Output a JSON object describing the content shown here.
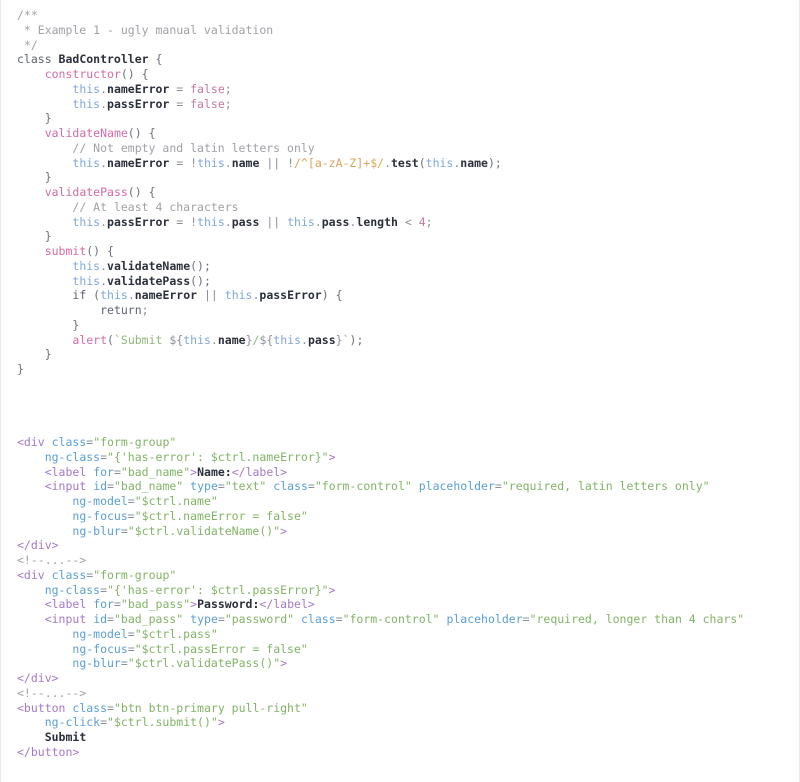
{
  "document": {
    "type": "code-listing",
    "title": "Example 1 - ugly manual validation",
    "background_color": "#ffffff",
    "font": "monospace",
    "colors": {
      "comment": "#a0a1a7",
      "keyword": "#5c6370",
      "function": "#d36ba6",
      "this": "#7fa8d6",
      "property": "#2b303b",
      "literal": "#c678a0",
      "regex": "#d8a657",
      "string": "#8cb87a",
      "tag": "#a579c9",
      "attribute": "#5a9fd4",
      "attribute_value": "#82b366",
      "text": "#2b303b",
      "border": "#e8e8e8"
    }
  },
  "js_block": {
    "language": "javascript",
    "lines": [
      [
        {
          "t": "/**",
          "c": "c"
        }
      ],
      [
        {
          "t": " * Example 1 - ugly manual validation",
          "c": "c"
        }
      ],
      [
        {
          "t": " */",
          "c": "c"
        }
      ],
      [
        {
          "t": "class ",
          "c": "kw"
        },
        {
          "t": "BadController",
          "c": "cls"
        },
        {
          "t": " {",
          "c": "pun"
        }
      ],
      [
        {
          "t": "    ",
          "c": "pun"
        },
        {
          "t": "constructor",
          "c": "fn"
        },
        {
          "t": "() {",
          "c": "pun"
        }
      ],
      [
        {
          "t": "        ",
          "c": "pun"
        },
        {
          "t": "this",
          "c": "th"
        },
        {
          "t": ".",
          "c": "op"
        },
        {
          "t": "nameError",
          "c": "prop"
        },
        {
          "t": " = ",
          "c": "op"
        },
        {
          "t": "false",
          "c": "val"
        },
        {
          "t": ";",
          "c": "op"
        }
      ],
      [
        {
          "t": "        ",
          "c": "pun"
        },
        {
          "t": "this",
          "c": "th"
        },
        {
          "t": ".",
          "c": "op"
        },
        {
          "t": "passError",
          "c": "prop"
        },
        {
          "t": " = ",
          "c": "op"
        },
        {
          "t": "false",
          "c": "val"
        },
        {
          "t": ";",
          "c": "op"
        }
      ],
      [
        {
          "t": "    }",
          "c": "pun"
        }
      ],
      [
        {
          "t": "    ",
          "c": "pun"
        },
        {
          "t": "validateName",
          "c": "fn"
        },
        {
          "t": "() {",
          "c": "pun"
        }
      ],
      [
        {
          "t": "        ",
          "c": "pun"
        },
        {
          "t": "// Not empty and latin letters only",
          "c": "c"
        }
      ],
      [
        {
          "t": "        ",
          "c": "pun"
        },
        {
          "t": "this",
          "c": "th"
        },
        {
          "t": ".",
          "c": "op"
        },
        {
          "t": "nameError",
          "c": "prop"
        },
        {
          "t": " = ",
          "c": "op"
        },
        {
          "t": "!",
          "c": "op"
        },
        {
          "t": "this",
          "c": "th"
        },
        {
          "t": ".",
          "c": "op"
        },
        {
          "t": "name",
          "c": "prop"
        },
        {
          "t": " || ",
          "c": "op"
        },
        {
          "t": "!",
          "c": "op"
        },
        {
          "t": "/^[a-zA-Z]+$/",
          "c": "re"
        },
        {
          "t": ".",
          "c": "op"
        },
        {
          "t": "test",
          "c": "prop"
        },
        {
          "t": "(",
          "c": "pun"
        },
        {
          "t": "this",
          "c": "th"
        },
        {
          "t": ".",
          "c": "op"
        },
        {
          "t": "name",
          "c": "prop"
        },
        {
          "t": ");",
          "c": "pun"
        }
      ],
      [
        {
          "t": "    }",
          "c": "pun"
        }
      ],
      [
        {
          "t": "    ",
          "c": "pun"
        },
        {
          "t": "validatePass",
          "c": "fn"
        },
        {
          "t": "() {",
          "c": "pun"
        }
      ],
      [
        {
          "t": "        ",
          "c": "pun"
        },
        {
          "t": "// At least 4 characters",
          "c": "c"
        }
      ],
      [
        {
          "t": "        ",
          "c": "pun"
        },
        {
          "t": "this",
          "c": "th"
        },
        {
          "t": ".",
          "c": "op"
        },
        {
          "t": "passError",
          "c": "prop"
        },
        {
          "t": " = ",
          "c": "op"
        },
        {
          "t": "!",
          "c": "op"
        },
        {
          "t": "this",
          "c": "th"
        },
        {
          "t": ".",
          "c": "op"
        },
        {
          "t": "pass",
          "c": "prop"
        },
        {
          "t": " || ",
          "c": "op"
        },
        {
          "t": "this",
          "c": "th"
        },
        {
          "t": ".",
          "c": "op"
        },
        {
          "t": "pass",
          "c": "prop"
        },
        {
          "t": ".",
          "c": "op"
        },
        {
          "t": "length",
          "c": "prop"
        },
        {
          "t": " < ",
          "c": "op"
        },
        {
          "t": "4",
          "c": "num"
        },
        {
          "t": ";",
          "c": "op"
        }
      ],
      [
        {
          "t": "    }",
          "c": "pun"
        }
      ],
      [
        {
          "t": "    ",
          "c": "pun"
        },
        {
          "t": "submit",
          "c": "fn"
        },
        {
          "t": "() {",
          "c": "pun"
        }
      ],
      [
        {
          "t": "        ",
          "c": "pun"
        },
        {
          "t": "this",
          "c": "th"
        },
        {
          "t": ".",
          "c": "op"
        },
        {
          "t": "validateName",
          "c": "prop"
        },
        {
          "t": "();",
          "c": "pun"
        }
      ],
      [
        {
          "t": "        ",
          "c": "pun"
        },
        {
          "t": "this",
          "c": "th"
        },
        {
          "t": ".",
          "c": "op"
        },
        {
          "t": "validatePass",
          "c": "prop"
        },
        {
          "t": "();",
          "c": "pun"
        }
      ],
      [
        {
          "t": "        ",
          "c": "pun"
        },
        {
          "t": "if",
          "c": "kw"
        },
        {
          "t": " (",
          "c": "pun"
        },
        {
          "t": "this",
          "c": "th"
        },
        {
          "t": ".",
          "c": "op"
        },
        {
          "t": "nameError",
          "c": "prop"
        },
        {
          "t": " || ",
          "c": "op"
        },
        {
          "t": "this",
          "c": "th"
        },
        {
          "t": ".",
          "c": "op"
        },
        {
          "t": "passError",
          "c": "prop"
        },
        {
          "t": ") {",
          "c": "pun"
        }
      ],
      [
        {
          "t": "            ",
          "c": "pun"
        },
        {
          "t": "return",
          "c": "kw"
        },
        {
          "t": ";",
          "c": "op"
        }
      ],
      [
        {
          "t": "        }",
          "c": "pun"
        }
      ],
      [
        {
          "t": "        ",
          "c": "pun"
        },
        {
          "t": "alert",
          "c": "fn"
        },
        {
          "t": "(",
          "c": "pun"
        },
        {
          "t": "`",
          "c": "str"
        },
        {
          "t": "Submit ",
          "c": "str"
        },
        {
          "t": "${",
          "c": "op"
        },
        {
          "t": "this",
          "c": "th"
        },
        {
          "t": ".",
          "c": "op"
        },
        {
          "t": "name",
          "c": "prop"
        },
        {
          "t": "}",
          "c": "op"
        },
        {
          "t": "/",
          "c": "str"
        },
        {
          "t": "${",
          "c": "op"
        },
        {
          "t": "this",
          "c": "th"
        },
        {
          "t": ".",
          "c": "op"
        },
        {
          "t": "pass",
          "c": "prop"
        },
        {
          "t": "}",
          "c": "op"
        },
        {
          "t": "`",
          "c": "str"
        },
        {
          "t": ");",
          "c": "pun"
        }
      ],
      [
        {
          "t": "    }",
          "c": "pun"
        }
      ],
      [
        {
          "t": "}",
          "c": "pun"
        }
      ]
    ]
  },
  "html_block": {
    "language": "html",
    "lines": [
      [
        {
          "t": "<div",
          "c": "tag"
        },
        {
          "t": " ",
          "c": "pun"
        },
        {
          "t": "class",
          "c": "attr"
        },
        {
          "t": "=",
          "c": "eq"
        },
        {
          "t": "\"form-group\"",
          "c": "aval"
        }
      ],
      [
        {
          "t": "    ",
          "c": "pun"
        },
        {
          "t": "ng-class",
          "c": "attr"
        },
        {
          "t": "=",
          "c": "eq"
        },
        {
          "t": "\"{'has-error': $ctrl.nameError}\"",
          "c": "aval"
        },
        {
          "t": ">",
          "c": "tag"
        }
      ],
      [
        {
          "t": "    ",
          "c": "pun"
        },
        {
          "t": "<label",
          "c": "tag"
        },
        {
          "t": " ",
          "c": "pun"
        },
        {
          "t": "for",
          "c": "attr"
        },
        {
          "t": "=",
          "c": "eq"
        },
        {
          "t": "\"bad_name\"",
          "c": "aval"
        },
        {
          "t": ">",
          "c": "tag"
        },
        {
          "t": "Name:",
          "c": "txt"
        },
        {
          "t": "</label>",
          "c": "tag"
        }
      ],
      [
        {
          "t": "    ",
          "c": "pun"
        },
        {
          "t": "<input",
          "c": "tag"
        },
        {
          "t": " ",
          "c": "pun"
        },
        {
          "t": "id",
          "c": "attr"
        },
        {
          "t": "=",
          "c": "eq"
        },
        {
          "t": "\"bad_name\"",
          "c": "aval"
        },
        {
          "t": " ",
          "c": "pun"
        },
        {
          "t": "type",
          "c": "attr"
        },
        {
          "t": "=",
          "c": "eq"
        },
        {
          "t": "\"text\"",
          "c": "aval"
        },
        {
          "t": " ",
          "c": "pun"
        },
        {
          "t": "class",
          "c": "attr"
        },
        {
          "t": "=",
          "c": "eq"
        },
        {
          "t": "\"form-control\"",
          "c": "aval"
        },
        {
          "t": " ",
          "c": "pun"
        },
        {
          "t": "placeholder",
          "c": "attr"
        },
        {
          "t": "=",
          "c": "eq"
        },
        {
          "t": "\"required, latin letters only\"",
          "c": "aval"
        }
      ],
      [
        {
          "t": "        ",
          "c": "pun"
        },
        {
          "t": "ng-model",
          "c": "attr"
        },
        {
          "t": "=",
          "c": "eq"
        },
        {
          "t": "\"$ctrl.name\"",
          "c": "aval"
        }
      ],
      [
        {
          "t": "        ",
          "c": "pun"
        },
        {
          "t": "ng-focus",
          "c": "attr"
        },
        {
          "t": "=",
          "c": "eq"
        },
        {
          "t": "\"$ctrl.nameError = false\"",
          "c": "aval"
        }
      ],
      [
        {
          "t": "        ",
          "c": "pun"
        },
        {
          "t": "ng-blur",
          "c": "attr"
        },
        {
          "t": "=",
          "c": "eq"
        },
        {
          "t": "\"$ctrl.validateName()\"",
          "c": "aval"
        },
        {
          "t": ">",
          "c": "tag"
        }
      ],
      [
        {
          "t": "</div>",
          "c": "tag"
        }
      ],
      [
        {
          "t": "<!--...-->",
          "c": "hcom"
        }
      ],
      [
        {
          "t": "<div",
          "c": "tag"
        },
        {
          "t": " ",
          "c": "pun"
        },
        {
          "t": "class",
          "c": "attr"
        },
        {
          "t": "=",
          "c": "eq"
        },
        {
          "t": "\"form-group\"",
          "c": "aval"
        }
      ],
      [
        {
          "t": "    ",
          "c": "pun"
        },
        {
          "t": "ng-class",
          "c": "attr"
        },
        {
          "t": "=",
          "c": "eq"
        },
        {
          "t": "\"{'has-error': $ctrl.passError}\"",
          "c": "aval"
        },
        {
          "t": ">",
          "c": "tag"
        }
      ],
      [
        {
          "t": "    ",
          "c": "pun"
        },
        {
          "t": "<label",
          "c": "tag"
        },
        {
          "t": " ",
          "c": "pun"
        },
        {
          "t": "for",
          "c": "attr"
        },
        {
          "t": "=",
          "c": "eq"
        },
        {
          "t": "\"bad_pass\"",
          "c": "aval"
        },
        {
          "t": ">",
          "c": "tag"
        },
        {
          "t": "Password:",
          "c": "txt"
        },
        {
          "t": "</label>",
          "c": "tag"
        }
      ],
      [
        {
          "t": "    ",
          "c": "pun"
        },
        {
          "t": "<input",
          "c": "tag"
        },
        {
          "t": " ",
          "c": "pun"
        },
        {
          "t": "id",
          "c": "attr"
        },
        {
          "t": "=",
          "c": "eq"
        },
        {
          "t": "\"bad_pass\"",
          "c": "aval"
        },
        {
          "t": " ",
          "c": "pun"
        },
        {
          "t": "type",
          "c": "attr"
        },
        {
          "t": "=",
          "c": "eq"
        },
        {
          "t": "\"password\"",
          "c": "aval"
        },
        {
          "t": " ",
          "c": "pun"
        },
        {
          "t": "class",
          "c": "attr"
        },
        {
          "t": "=",
          "c": "eq"
        },
        {
          "t": "\"form-control\"",
          "c": "aval"
        },
        {
          "t": " ",
          "c": "pun"
        },
        {
          "t": "placeholder",
          "c": "attr"
        },
        {
          "t": "=",
          "c": "eq"
        },
        {
          "t": "\"required, longer than 4 chars\"",
          "c": "aval"
        }
      ],
      [
        {
          "t": "        ",
          "c": "pun"
        },
        {
          "t": "ng-model",
          "c": "attr"
        },
        {
          "t": "=",
          "c": "eq"
        },
        {
          "t": "\"$ctrl.pass\"",
          "c": "aval"
        }
      ],
      [
        {
          "t": "        ",
          "c": "pun"
        },
        {
          "t": "ng-focus",
          "c": "attr"
        },
        {
          "t": "=",
          "c": "eq"
        },
        {
          "t": "\"$ctrl.passError = false\"",
          "c": "aval"
        }
      ],
      [
        {
          "t": "        ",
          "c": "pun"
        },
        {
          "t": "ng-blur",
          "c": "attr"
        },
        {
          "t": "=",
          "c": "eq"
        },
        {
          "t": "\"$ctrl.validatePass()\"",
          "c": "aval"
        },
        {
          "t": ">",
          "c": "tag"
        }
      ],
      [
        {
          "t": "</div>",
          "c": "tag"
        }
      ],
      [
        {
          "t": "<!--...-->",
          "c": "hcom"
        }
      ],
      [
        {
          "t": "<button",
          "c": "tag"
        },
        {
          "t": " ",
          "c": "pun"
        },
        {
          "t": "class",
          "c": "attr"
        },
        {
          "t": "=",
          "c": "eq"
        },
        {
          "t": "\"btn btn-primary pull-right\"",
          "c": "aval"
        }
      ],
      [
        {
          "t": "    ",
          "c": "pun"
        },
        {
          "t": "ng-click",
          "c": "attr"
        },
        {
          "t": "=",
          "c": "eq"
        },
        {
          "t": "\"$ctrl.submit()\"",
          "c": "aval"
        },
        {
          "t": ">",
          "c": "tag"
        }
      ],
      [
        {
          "t": "    ",
          "c": "pun"
        },
        {
          "t": "Submit",
          "c": "txt"
        }
      ],
      [
        {
          "t": "</button>",
          "c": "tag"
        }
      ]
    ]
  }
}
